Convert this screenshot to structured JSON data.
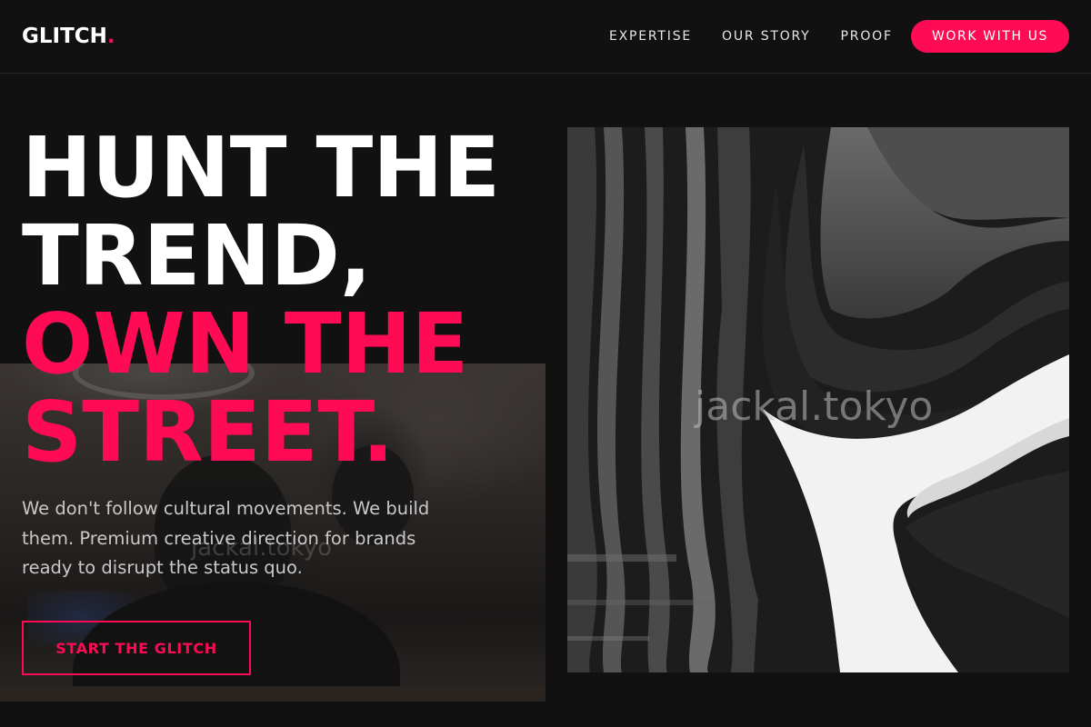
{
  "brand": {
    "name": "GLITCH",
    "dot": ".",
    "accent_color": "#ff0a54"
  },
  "nav": {
    "items": [
      {
        "label": "EXPERTISE"
      },
      {
        "label": "OUR STORY"
      },
      {
        "label": "PROOF"
      }
    ],
    "cta_label": "WORK WITH US"
  },
  "hero": {
    "line1": "HUNT THE",
    "line2": "TREND,",
    "line3": "OWN THE",
    "line4": "STREET.",
    "description": "We don't follow cultural movements. We build them. Premium creative direction for brands ready to disrupt the status quo.",
    "cta_label": "START THE GLITCH"
  },
  "images": {
    "background_watermark": "jackal.tokyo",
    "art_watermark": "jackal.tokyo"
  }
}
